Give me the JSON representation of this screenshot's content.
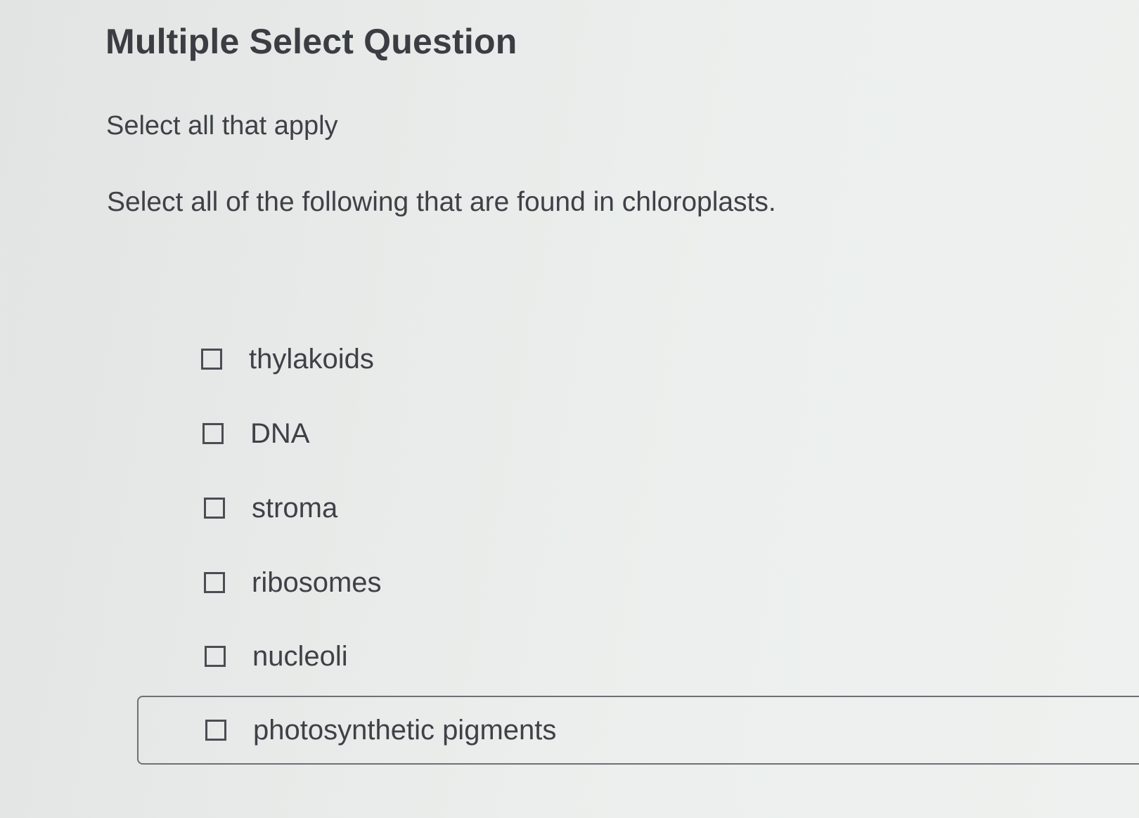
{
  "question": {
    "title": "Multiple Select Question",
    "instruction": "Select all that apply",
    "prompt": "Select all of the following that are found in chloroplasts."
  },
  "options": [
    {
      "label": "thylakoids",
      "checked": false
    },
    {
      "label": "DNA",
      "checked": false
    },
    {
      "label": "stroma",
      "checked": false
    },
    {
      "label": "ribosomes",
      "checked": false
    },
    {
      "label": "nucleoli",
      "checked": false
    },
    {
      "label": "photosynthetic pigments",
      "checked": false,
      "focused": true
    }
  ]
}
